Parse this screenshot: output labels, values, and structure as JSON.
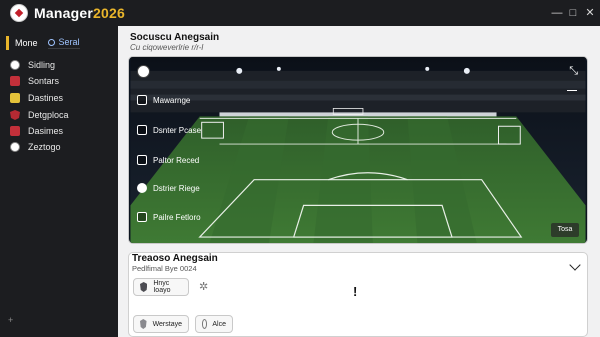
{
  "app": {
    "title": "Manager",
    "year": "2026"
  },
  "window_controls": {
    "minimize": "—",
    "maximize": "□",
    "close": "✕"
  },
  "sidebar": {
    "home_label": "Mone",
    "search_label": "Seral",
    "items": [
      {
        "label": "Sidling",
        "icon": "soccer-ball-icon"
      },
      {
        "label": "Sontars",
        "icon": "red-badge-icon"
      },
      {
        "label": "Dastines",
        "icon": "yellow-card-icon"
      },
      {
        "label": "Detgploca",
        "icon": "red-shield-icon"
      },
      {
        "label": "Dasimes",
        "icon": "red-badge-icon"
      },
      {
        "label": "Zeztogo",
        "icon": "soccer-ball-icon"
      }
    ],
    "footer": "+"
  },
  "main": {
    "section_title": "Socuscu Anegsain",
    "section_subtitle": "Cu ciqoweverlrie r/r-l",
    "pitch": {
      "overlay_items": [
        "Mawarnge",
        "Dsnter Pcase",
        "Paltor Reced",
        "Dstrier Riege",
        "Pailre Fetloro"
      ],
      "corner_button": "Tosa"
    },
    "lower": {
      "title": "Treaoso Anegsain",
      "subtitle": "Pedlfimal Bye 0024",
      "chips": [
        "Hnyc Ioayo",
        "Werstaye",
        "Alce"
      ],
      "alert": "!"
    }
  }
}
